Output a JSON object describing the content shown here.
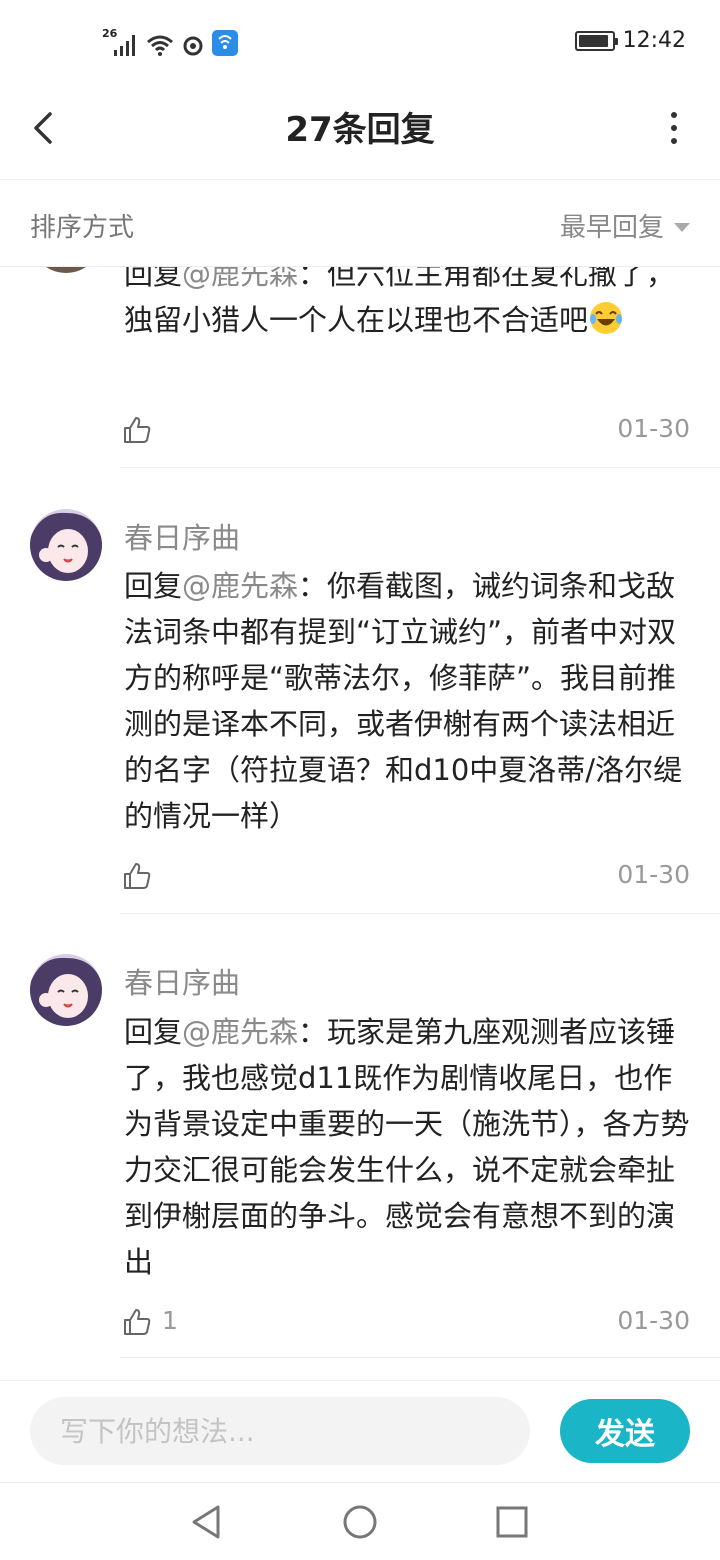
{
  "status_bar": {
    "network": "26",
    "time": "12:42",
    "battery_level": 0.92
  },
  "header": {
    "title": "27条回复",
    "back_icon": "chevron-left-icon",
    "more_icon": "more-vertical-icon"
  },
  "sort": {
    "label": "排序方式",
    "value": "最早回复"
  },
  "replies": [
    {
      "author": "",
      "reply_prefix": "回复",
      "mention": "@鹿先森",
      "text": "：但六位主角都在夏礼撒了，独留小猎人一个人在以理也不合适吧",
      "emoji": "laughing-tears-emoji",
      "likes": "",
      "date": "01-30"
    },
    {
      "author": "春日序曲",
      "reply_prefix": "回复",
      "mention": "@鹿先森",
      "text": "：你看截图，诫约词条和戈敌法词条中都有提到“订立诫约”，前者中对双方的称呼是“歌蒂法尔，修菲萨”。我目前推测的是译本不同，或者伊榭有两个读法相近的名字（符拉夏语？和d10中夏洛蒂/洛尔缇的情况一样）",
      "likes": "",
      "date": "01-30"
    },
    {
      "author": "春日序曲",
      "reply_prefix": "回复",
      "mention": "@鹿先森",
      "text": "：玩家是第九座观测者应该锤了，我也感觉d11既作为剧情收尾日，也作为背景设定中重要的一天（施洗节），各方势力交汇很可能会发生什么，说不定就会牵扯到伊榭层面的争斗。感觉会有意想不到的演出",
      "likes": "1",
      "date": "01-30"
    }
  ],
  "input": {
    "placeholder": "写下你的想法...",
    "send_label": "发送"
  },
  "colors": {
    "accent": "#1ab5c7",
    "muted": "#8a8a8a"
  }
}
